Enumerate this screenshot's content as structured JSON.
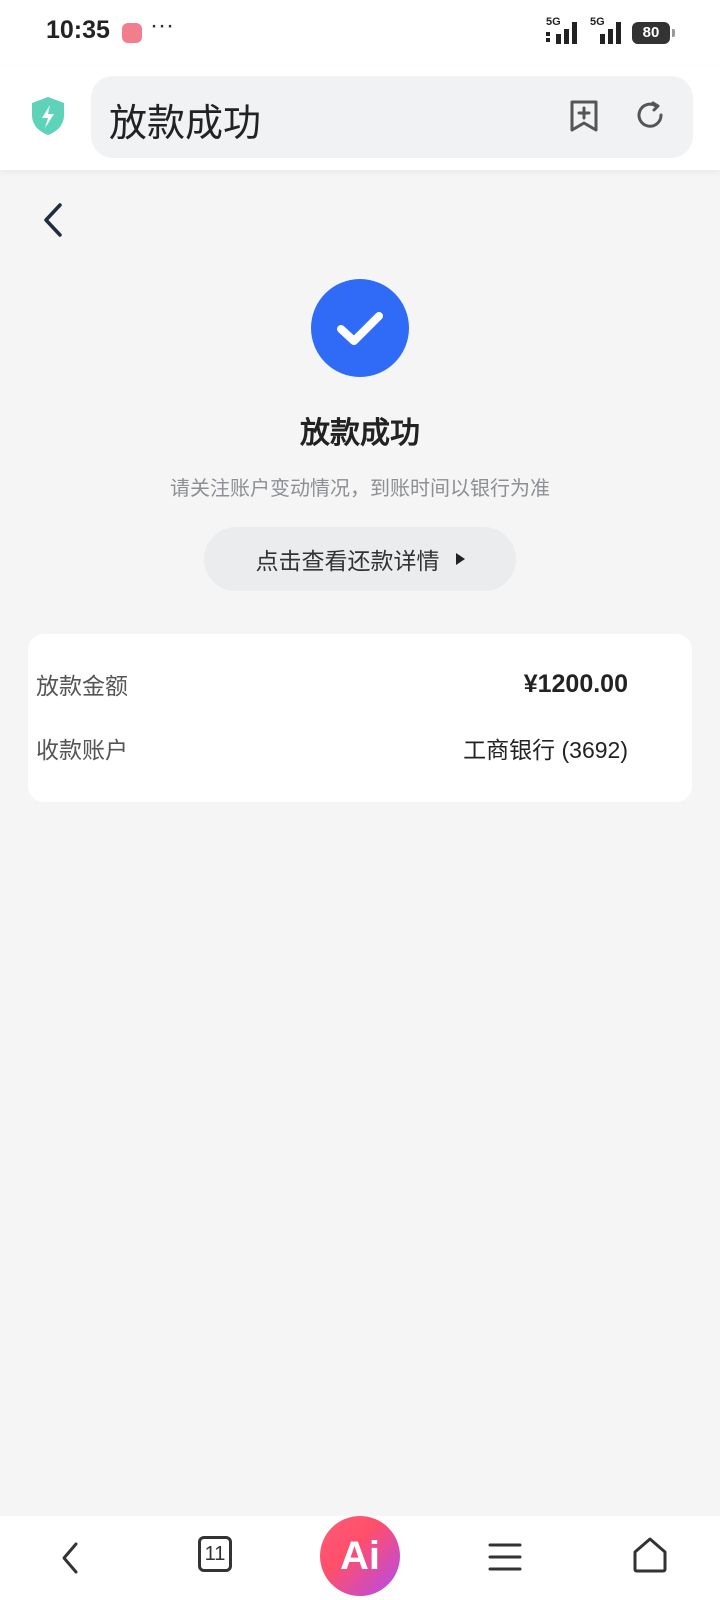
{
  "status_bar": {
    "time": "10:35",
    "more": "···",
    "signal_1": "5G",
    "signal_2": "5G",
    "battery": "80"
  },
  "browser": {
    "title": "放款成功"
  },
  "result": {
    "title": "放款成功",
    "subtitle": "请关注账户变动情况，到账时间以银行为准",
    "detail_button": "点击查看还款详情"
  },
  "info": {
    "rows": [
      {
        "label": "放款金额",
        "value": "¥1200.00"
      },
      {
        "label": "收款账户",
        "value": "工商银行 (3692)"
      }
    ]
  },
  "bottom_nav": {
    "tabs_count": "11",
    "ai_label": "Ai"
  },
  "colors": {
    "accent": "#2f6bf6",
    "shield": "#5fd3b9",
    "background": "#f5f5f6"
  }
}
